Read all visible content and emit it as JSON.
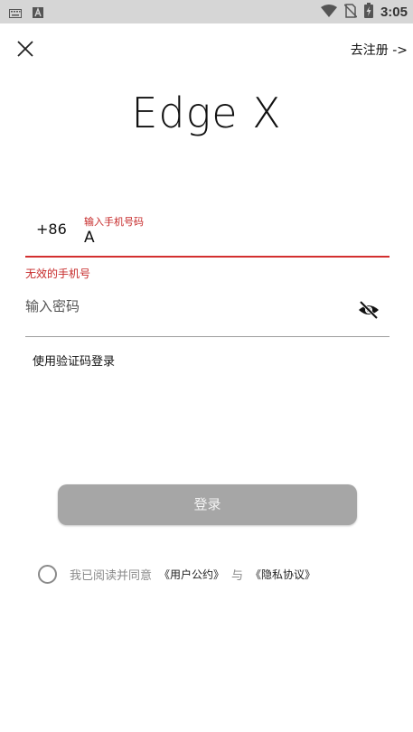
{
  "status_bar": {
    "time": "3:05",
    "icons": [
      "keyboard-icon",
      "font-a-icon",
      "wifi-icon",
      "no-sim-icon",
      "battery-charging-icon"
    ]
  },
  "header": {
    "register_link": "去注册 ->"
  },
  "brand": {
    "logo_text": "Edge X"
  },
  "form": {
    "country_code": "+86",
    "phone_label": "输入手机号码",
    "phone_value": "A",
    "phone_error": "无效的手机号",
    "password_placeholder": "输入密码",
    "sms_login_link": "使用验证码登录",
    "login_button": "登录"
  },
  "agreement": {
    "prefix": "我已阅读并同意",
    "user_agreement": "《用户公约》",
    "conjunction": "与",
    "privacy_policy": "《隐私协议》"
  },
  "colors": {
    "error_red": "#c62828",
    "button_gray": "#a6a6a6",
    "status_bar_bg": "#d6d6d6"
  }
}
